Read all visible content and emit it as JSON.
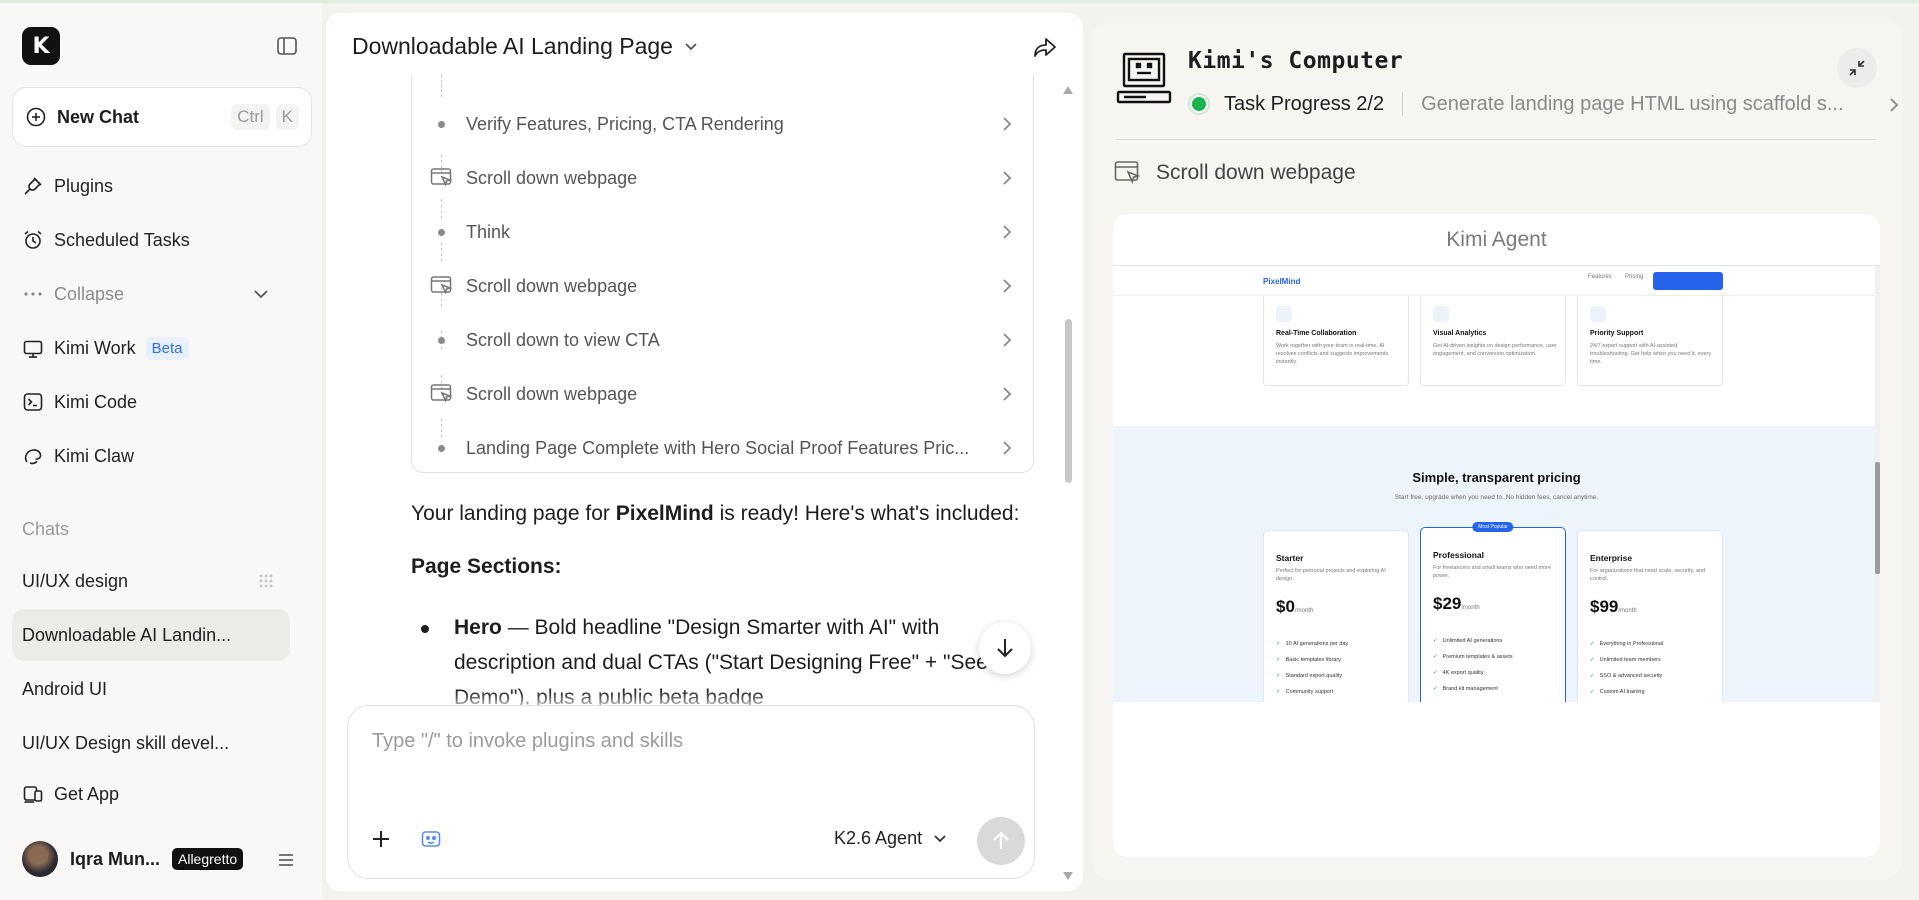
{
  "sidebar": {
    "logo": "K",
    "new_chat": {
      "label": "New Chat",
      "kbd1": "Ctrl",
      "kbd2": "K"
    },
    "nav": [
      {
        "label": "Plugins",
        "icon": "plug-icon"
      },
      {
        "label": "Scheduled Tasks",
        "icon": "alarm-clock-icon"
      },
      {
        "label": "Collapse",
        "icon": "more-dots-icon"
      },
      {
        "label": "Kimi Work",
        "icon": "monitor-icon",
        "badge": "Beta"
      },
      {
        "label": "Kimi Code",
        "icon": "terminal-icon"
      },
      {
        "label": "Kimi Claw",
        "icon": "claw-icon"
      }
    ],
    "chats_label": "Chats",
    "chats": [
      {
        "label": "UI/UX design"
      },
      {
        "label": "Downloadable AI Landin...",
        "active": true
      },
      {
        "label": "Android UI"
      },
      {
        "label": "UI/UX Design skill devel..."
      }
    ],
    "get_app": "Get App",
    "user": {
      "name": "Iqra Mun...",
      "plan": "Allegretto"
    }
  },
  "main": {
    "title": "Downloadable AI Landing Page",
    "steps": [
      {
        "type": "think",
        "label": "Verify Features, Pricing, CTA Rendering"
      },
      {
        "type": "browser",
        "label": "Scroll down webpage"
      },
      {
        "type": "think",
        "label": "Think"
      },
      {
        "type": "browser",
        "label": "Scroll down webpage"
      },
      {
        "type": "think",
        "label": "Scroll down to view CTA"
      },
      {
        "type": "browser",
        "label": "Scroll down webpage"
      },
      {
        "type": "think",
        "label": "Landing Page Complete with Hero Social Proof Features Pric..."
      }
    ],
    "message": {
      "pre": "Your landing page for ",
      "brand": "PixelMind",
      "post": " is ready! Here's what's included:"
    },
    "sections_heading": "Page Sections:",
    "hero_item": {
      "title": "Hero",
      "text": " — Bold headline \"Design Smarter with AI\" with description and dual CTAs (\"Start Designing Free\" + \"See Demo\"), plus a public beta badge"
    },
    "composer": {
      "placeholder": "Type \"/\" to invoke plugins and skills",
      "model": "K2.6 Agent"
    }
  },
  "computer": {
    "title": "Kimi's Computer",
    "progress_label": "Task Progress 2/2",
    "progress_task": "Generate landing page HTML using scaffold s...",
    "action": "Scroll down webpage",
    "browser_title": "Kimi Agent",
    "site": {
      "brand": "PixelMind",
      "nav_links": [
        "Features",
        "Pricing"
      ],
      "features": [
        {
          "title": "Real-Time Collaboration",
          "desc": "Work together with your team in real-time. AI resolves conflicts and suggests improvements instantly."
        },
        {
          "title": "Visual Analytics",
          "desc": "Get AI-driven insights on design performance, user engagement, and conversion optimization."
        },
        {
          "title": "Priority Support",
          "desc": "24/7 expert support with AI-assisted troubleshooting. Get help when you need it, every time."
        }
      ],
      "pricing_title": "Simple, transparent pricing",
      "pricing_sub": "Start free, upgrade when you need to. No hidden fees, cancel anytime.",
      "popular_badge": "Most Popular",
      "plans": [
        {
          "name": "Starter",
          "desc": "Perfect for personal projects and exploring AI design.",
          "price": "$0",
          "period": "/month",
          "features": [
            "10 AI generations per day",
            "Basic templates library",
            "Standard export quality",
            "Community support"
          ]
        },
        {
          "name": "Professional",
          "desc": "For freelancers and small teams who need more power.",
          "price": "$29",
          "period": "/month",
          "features": [
            "Unlimited AI generations",
            "Premium templates & assets",
            "4K export quality",
            "Brand kit management"
          ]
        },
        {
          "name": "Enterprise",
          "desc": "For organizations that need scale, security, and control.",
          "price": "$99",
          "period": "/month",
          "features": [
            "Everything in Professional",
            "Unlimited team members",
            "SSO & advanced security",
            "Custom AI training"
          ]
        }
      ]
    }
  }
}
